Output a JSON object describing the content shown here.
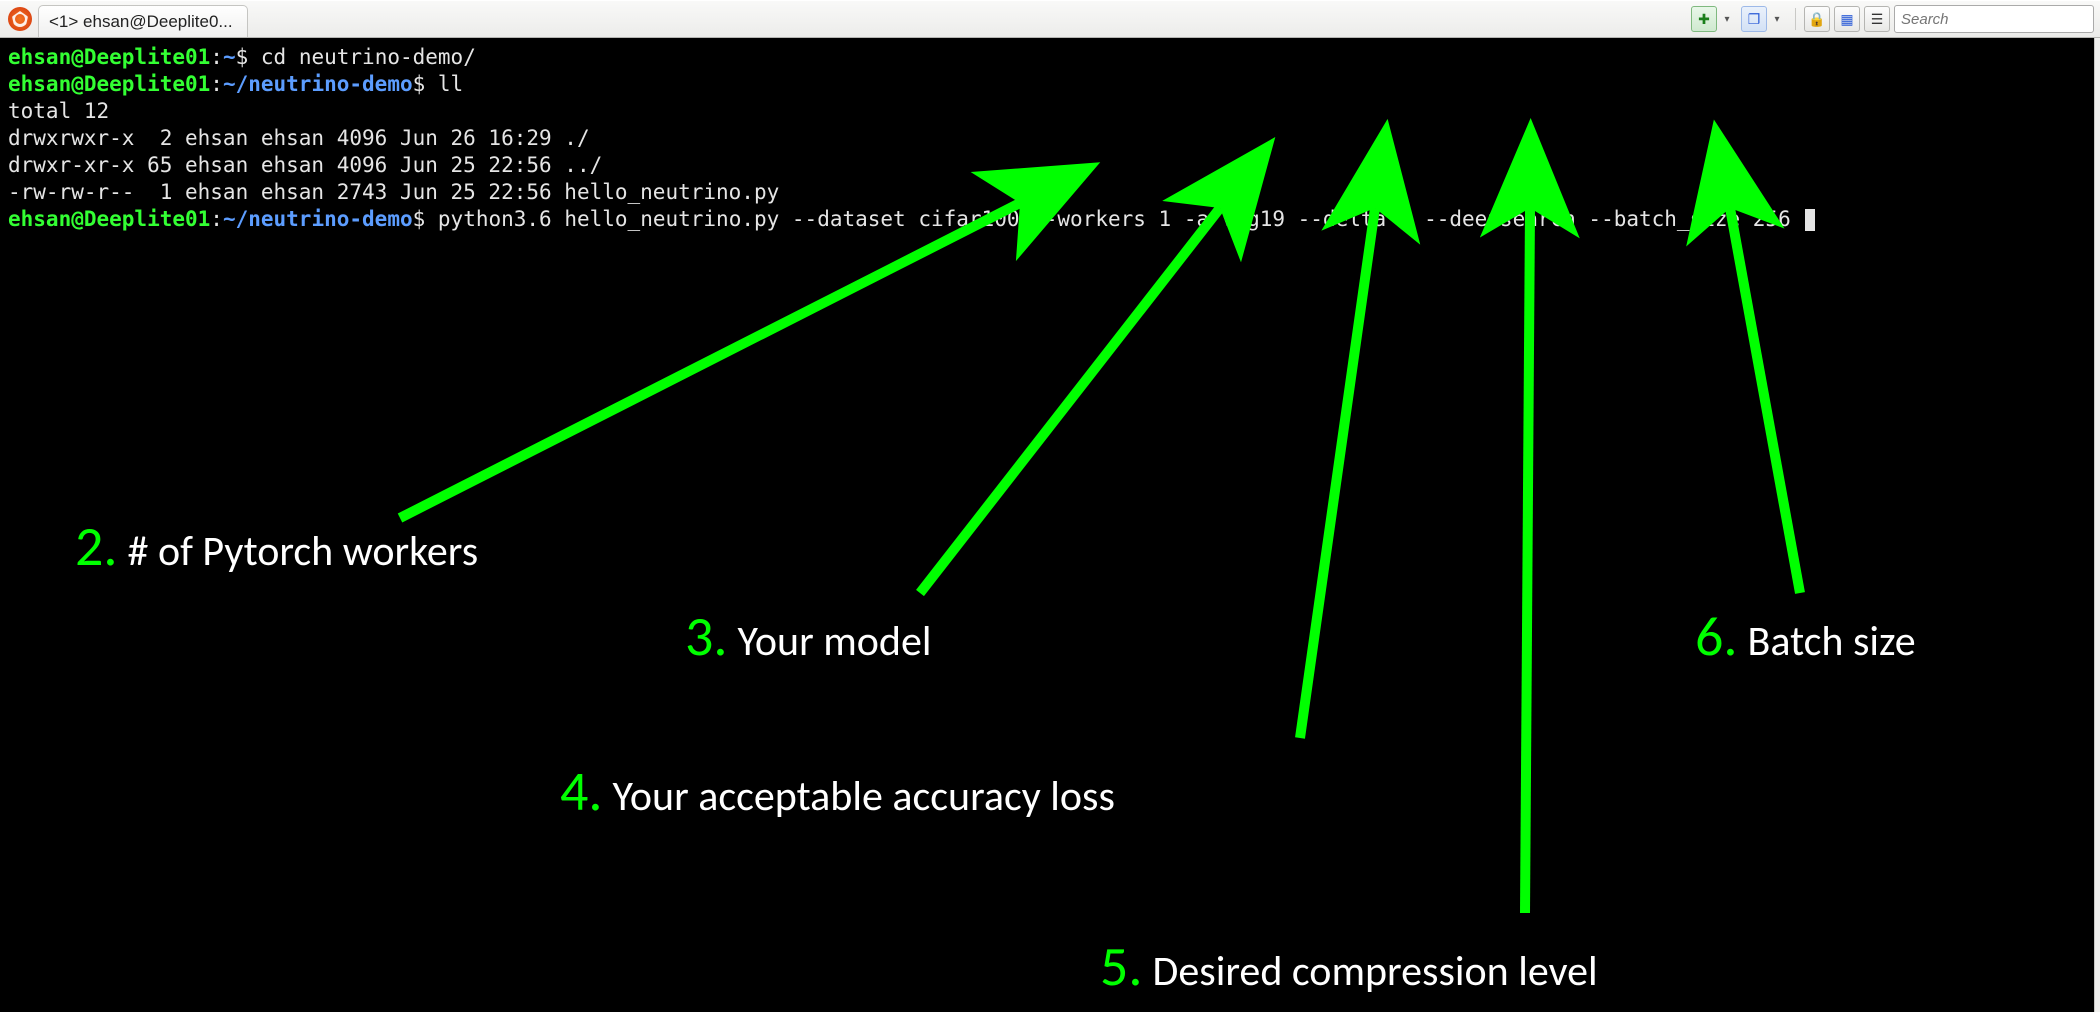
{
  "titlebar": {
    "tab_title": "<1> ehsan@Deeplite0...",
    "search_placeholder": "Search"
  },
  "prompt": {
    "user_host": "ehsan@Deeplite01",
    "home_cwd": "~",
    "demo_cwd": "~/neutrino-demo"
  },
  "terminal": {
    "cmd1": "cd neutrino-demo/",
    "cmd2": "ll",
    "total_line": "total 12",
    "ls_rows": [
      "drwxrwxr-x  2 ehsan ehsan 4096 Jun 26 16:29 ./",
      "drwxr-xr-x 65 ehsan ehsan 4096 Jun 25 22:56 ../",
      "-rw-rw-r--  1 ehsan ehsan 2743 Jun 25 22:56 hello_neutrino.py"
    ],
    "cmd3": "python3.6 hello_neutrino.py --dataset cifar100 --workers 1 -a vgg19 --delta 1 --deepsearch --batch_size 256"
  },
  "annotations": [
    {
      "num": "2.",
      "text": "# of Pytorch workers"
    },
    {
      "num": "3.",
      "text": "Your model"
    },
    {
      "num": "4.",
      "text": "Your acceptable accuracy loss"
    },
    {
      "num": "5.",
      "text": "Desired compression level"
    },
    {
      "num": "6.",
      "text": "Batch size"
    }
  ]
}
